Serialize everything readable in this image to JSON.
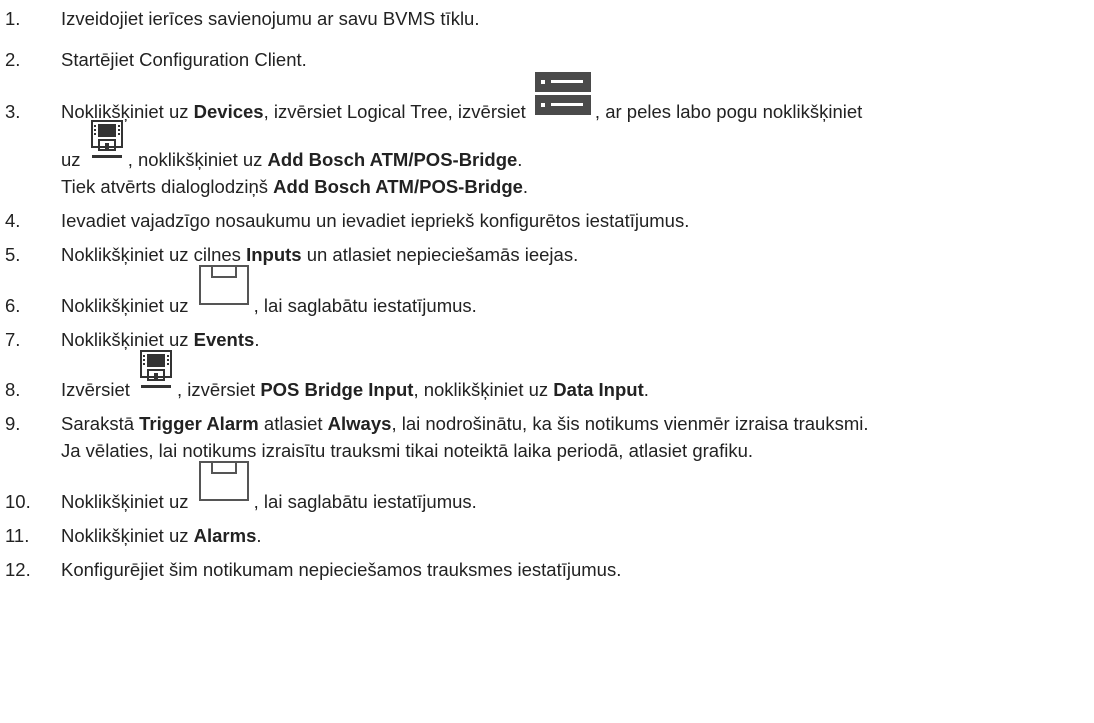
{
  "steps": [
    {
      "num": "1.",
      "parts": [
        "Izveidojiet ierīces savienojumu ar savu BVMS tīklu."
      ]
    },
    {
      "num": "2.",
      "parts": [
        "Startējiet Configuration Client."
      ]
    },
    {
      "num": "3.",
      "a": "Noklikšķiniet uz ",
      "b": "Devices",
      "c": ", izvērsiet Logical Tree, izvērsiet ",
      "d": ", ar peles labo pogu noklikšķiniet",
      "e": "uz ",
      "f": ", noklikšķiniet uz ",
      "g": "Add Bosch ATM/POS-Bridge",
      "h": ".",
      "i": "Tiek atvērts dialoglodziņš ",
      "j": "Add Bosch ATM/POS-Bridge",
      "k": "."
    },
    {
      "num": "4.",
      "text": "Ievadiet vajadzīgo nosaukumu un ievadiet iepriekš konfigurētos iestatījumus."
    },
    {
      "num": "5.",
      "a": "Noklikšķiniet uz cilnes ",
      "b": "Inputs",
      "c": " un atlasiet nepieciešamās ieejas."
    },
    {
      "num": "6.",
      "a": "Noklikšķiniet uz ",
      "b": ", lai saglabātu iestatījumus."
    },
    {
      "num": "7.",
      "a": "Noklikšķiniet uz ",
      "b": "Events",
      "c": "."
    },
    {
      "num": "8.",
      "a": "Izvērsiet ",
      "b": ", izvērsiet ",
      "c": "POS Bridge Input",
      "d": ", noklikšķiniet uz ",
      "e": "Data Input",
      "f": "."
    },
    {
      "num": "9.",
      "a": "Sarakstā ",
      "b": "Trigger Alarm",
      "c": " atlasiet ",
      "d": "Always",
      "e": ", lai nodrošinātu, ka šis notikums vienmēr izraisa trauksmi.",
      "f": "Ja vēlaties, lai notikums izraisītu trauksmi tikai noteiktā laika periodā, atlasiet grafiku."
    },
    {
      "num": "10.",
      "a": "Noklikšķiniet uz ",
      "b": ", lai saglabātu iestatījumus."
    },
    {
      "num": "11.",
      "a": "Noklikšķiniet uz ",
      "b": "Alarms",
      "c": "."
    },
    {
      "num": "12.",
      "text": "Konfigurējiet šim notikumam nepieciešamos trauksmes iestatījumus."
    }
  ],
  "icons": {
    "device_list": "server-list-icon",
    "atm_pos": "atm-pos-bridge-icon",
    "save": "save-icon"
  }
}
